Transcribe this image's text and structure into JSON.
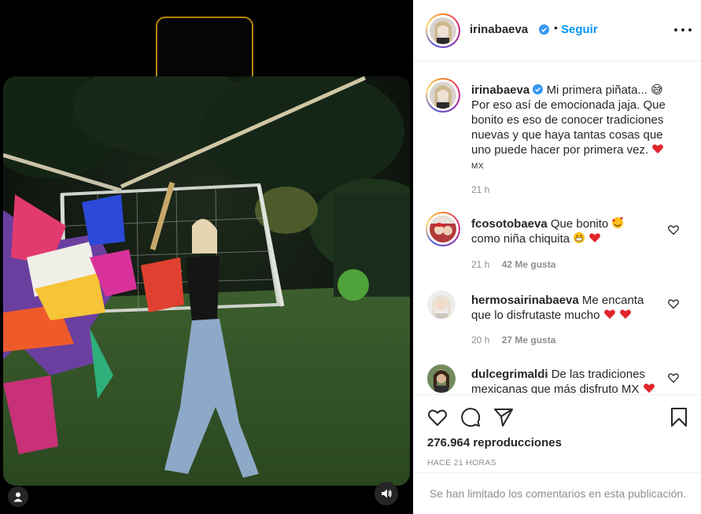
{
  "post": {
    "username": "irinabaeva",
    "follow_label": "Seguir",
    "separator": "•"
  },
  "caption": {
    "username": "irinabaeva",
    "line1": "Mi primera piñata... 😅",
    "line2": "Por eso así de emocionada jaja. Que",
    "line3": "bonito es eso de conocer tradiciones",
    "line4": "nuevas y que haya tantas cosas que",
    "line5": "uno puede hacer por primera vez.",
    "line6": "MX",
    "time": "21 h"
  },
  "comments": [
    {
      "username": "fcosotobaeva",
      "line1": "Que bonito",
      "line2": "como niña chiquita",
      "time": "21 h",
      "likes": "42 Me gusta"
    },
    {
      "username": "hermosairinabaeva",
      "line1": "Me encanta",
      "line2": "que lo disfrutaste mucho",
      "time": "20 h",
      "likes": "27 Me gusta"
    },
    {
      "username": "dulcegrimaldi",
      "line1": "De las tradiciones",
      "line2": "mexicanas que más disfruto MX"
    }
  ],
  "stats": {
    "views": "276.964 reproducciones",
    "posted": "HACE 21 HORAS"
  },
  "footer": {
    "limited_comments": "Se han limitado los comentarios en esta publicación."
  },
  "colors": {
    "link_blue": "#0095f6",
    "verified_blue": "#3897f0",
    "heart_red": "#ed4956",
    "muted_gray": "#8e8e8e"
  },
  "icons": [
    "user-icon",
    "sound-icon",
    "verified-icon",
    "more-icon",
    "heart-icon",
    "comment-icon",
    "share-icon",
    "bookmark-icon"
  ]
}
